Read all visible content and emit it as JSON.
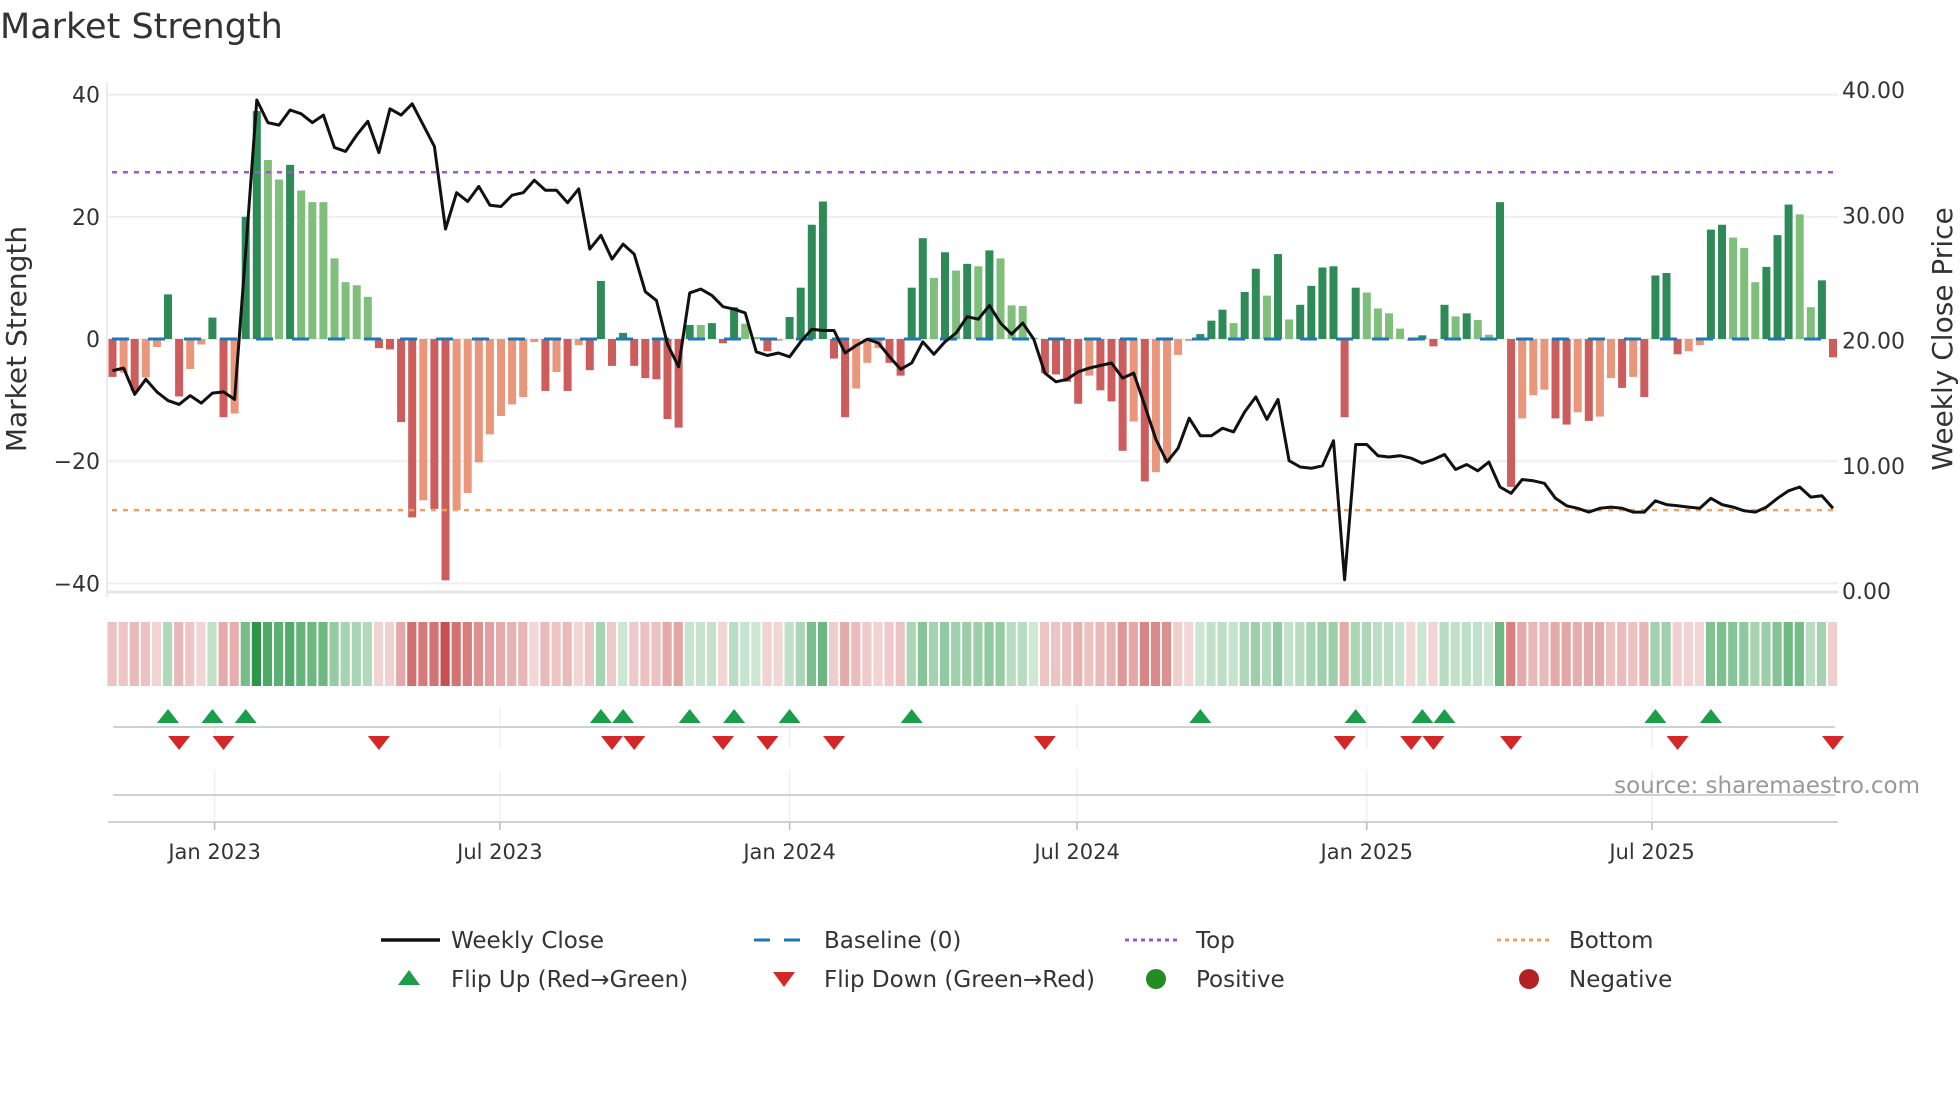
{
  "chart_data": {
    "type": "bar",
    "title": "Market Strength",
    "ylabel": "Market Strength",
    "y2label": "Weekly Close Price",
    "ylim": [
      -42,
      42
    ],
    "y2lim": [
      0,
      42
    ],
    "yticks": [
      {
        "v": 40,
        "label": "40"
      },
      {
        "v": 20,
        "label": "20"
      },
      {
        "v": 0,
        "label": "0"
      },
      {
        "v": -20,
        "label": "−20"
      },
      {
        "v": -40,
        "label": "−40"
      }
    ],
    "y2ticks": [
      {
        "v": 40,
        "label": "40.00"
      },
      {
        "v": 30,
        "label": "30.00"
      },
      {
        "v": 20,
        "label": "20.00"
      },
      {
        "v": 10,
        "label": "10.00"
      },
      {
        "v": 0,
        "label": "0.00"
      }
    ],
    "xticks": [
      {
        "week": 10.2,
        "label": "Jan 2023"
      },
      {
        "week": 35.9,
        "label": "Jul 2023"
      },
      {
        "week": 62.0,
        "label": "Jan 2024"
      },
      {
        "week": 87.9,
        "label": "Jul 2024"
      },
      {
        "week": 114.0,
        "label": "Jan 2025"
      },
      {
        "week": 139.7,
        "label": "Jul 2025"
      }
    ],
    "top_level": 27.3,
    "bottom_level": -28,
    "baseline": 0,
    "strength": [
      -6.2,
      -5.5,
      -8.5,
      -6.3,
      -1.3,
      7.3,
      -9.4,
      -4.9,
      -0.9,
      3.5,
      -12.8,
      -12.2,
      20,
      37.3,
      29.3,
      26.1,
      28.5,
      24.3,
      22.4,
      22.4,
      13.2,
      9.3,
      8.8,
      6.9,
      -1.5,
      -1.7,
      -13.6,
      -29.2,
      -26.4,
      -27.8,
      -39.5,
      -28,
      -25.2,
      -20.2,
      -15.6,
      -12.6,
      -10.7,
      -9.5,
      -0.5,
      -8.5,
      -5.4,
      -8.5,
      -1,
      -5.1,
      9.5,
      -4.4,
      1,
      -4.4,
      -6.4,
      -6.6,
      -13.1,
      -14.5,
      2.3,
      2.3,
      2.6,
      -0.7,
      5.2,
      2.5,
      0.3,
      -2,
      -0.3,
      3.6,
      8.4,
      18.7,
      22.5,
      -3.2,
      -12.8,
      -8.1,
      -3.9,
      -1.5,
      -3.9,
      -6,
      8.4,
      16.5,
      10,
      14.2,
      11.2,
      12.3,
      11.9,
      14.5,
      13.2,
      5.5,
      5.4,
      0.2,
      -5.6,
      -5.8,
      -7,
      -10.6,
      -6,
      -8.4,
      -10.2,
      -18.3,
      -13.5,
      -23.3,
      -21.8,
      -20.2,
      -2.6,
      -0.3,
      0.8,
      3,
      4.8,
      2.6,
      7.7,
      11.5,
      7.1,
      13.9,
      3.2,
      5.6,
      8.7,
      11.7,
      11.9,
      -12.8,
      8.4,
      7.6,
      5,
      4.2,
      1.7,
      -0.3,
      0.6,
      -1.2,
      5.6,
      3.7,
      4.2,
      3.1,
      0.7,
      22.4,
      -24.2,
      -13,
      -9.2,
      -8.3,
      -13,
      -14,
      -12,
      -13.4,
      -12.7,
      -6.4,
      -8,
      -6.2,
      -9.5,
      10.4,
      10.8,
      -2.5,
      -2,
      -1,
      17.9,
      18.7,
      16.6,
      14.9,
      9.3,
      11.8,
      17,
      22,
      20.4,
      5.2,
      9.6,
      -3
    ],
    "tones": [
      "R",
      "r",
      "R",
      "r",
      "r",
      "G",
      "R",
      "r",
      "r",
      "G",
      "R",
      "r",
      "G",
      "G",
      "g",
      "g",
      "G",
      "g",
      "g",
      "g",
      "g",
      "g",
      "g",
      "g",
      "R",
      "R",
      "R",
      "R",
      "r",
      "R",
      "R",
      "r",
      "r",
      "r",
      "r",
      "r",
      "r",
      "r",
      "r",
      "R",
      "r",
      "R",
      "r",
      "R",
      "G",
      "R",
      "G",
      "R",
      "R",
      "R",
      "R",
      "R",
      "G",
      "g",
      "G",
      "R",
      "G",
      "g",
      "g",
      "R",
      "r",
      "G",
      "G",
      "G",
      "G",
      "R",
      "R",
      "r",
      "r",
      "r",
      "R",
      "R",
      "G",
      "G",
      "g",
      "G",
      "g",
      "G",
      "g",
      "G",
      "g",
      "g",
      "g",
      "g",
      "R",
      "R",
      "R",
      "R",
      "r",
      "R",
      "R",
      "R",
      "r",
      "R",
      "r",
      "r",
      "r",
      "r",
      "G",
      "G",
      "G",
      "g",
      "G",
      "G",
      "g",
      "G",
      "g",
      "G",
      "G",
      "G",
      "G",
      "R",
      "G",
      "g",
      "g",
      "g",
      "g",
      "r",
      "G",
      "R",
      "G",
      "g",
      "G",
      "g",
      "g",
      "G",
      "R",
      "r",
      "r",
      "r",
      "R",
      "R",
      "r",
      "R",
      "r",
      "r",
      "R",
      "r",
      "R",
      "G",
      "G",
      "R",
      "r",
      "r",
      "G",
      "G",
      "g",
      "g",
      "g",
      "G",
      "G",
      "G",
      "g",
      "g",
      "G",
      "R"
    ],
    "weekly_close": [
      17.6,
      17.8,
      15.7,
      16.9,
      15.9,
      15.2,
      14.9,
      15.6,
      15.0,
      15.8,
      15.9,
      15.3,
      27.1,
      39.2,
      37.4,
      37.2,
      38.4,
      38.1,
      37.4,
      38.0,
      35.4,
      35.1,
      36.4,
      37.5,
      35.0,
      38.5,
      38.0,
      38.9,
      37.2,
      35.5,
      28.9,
      31.8,
      31.1,
      32.3,
      30.8,
      30.7,
      31.6,
      31.8,
      32.8,
      32.0,
      32.0,
      31.0,
      32.1,
      27.3,
      28.4,
      26.5,
      27.7,
      26.9,
      23.9,
      23.2,
      19.7,
      17.9,
      23.8,
      24.1,
      23.6,
      22.7,
      22.5,
      22.2,
      19.1,
      18.8,
      19.0,
      18.7,
      19.9,
      20.9,
      20.8,
      20.8,
      19.0,
      19.6,
      20.1,
      19.8,
      18.7,
      17.7,
      18.2,
      19.9,
      18.9,
      19.9,
      20.6,
      21.9,
      21.7,
      22.8,
      21.4,
      20.5,
      21.4,
      20.1,
      17.4,
      16.7,
      16.9,
      17.5,
      17.8,
      18.0,
      18.2,
      17.0,
      17.4,
      14.8,
      12.1,
      10.3,
      11.4,
      13.8,
      12.4,
      12.4,
      13.0,
      12.7,
      14.3,
      15.5,
      13.7,
      15.3,
      10.4,
      9.9,
      9.8,
      10.0,
      12.0,
      0.9,
      11.7,
      11.7,
      10.8,
      10.7,
      10.8,
      10.6,
      10.2,
      10.5,
      10.9,
      9.7,
      10.1,
      9.6,
      10.3,
      8.3,
      7.8,
      8.9,
      8.8,
      8.6,
      7.4,
      6.8,
      6.6,
      6.3,
      6.6,
      6.7,
      6.6,
      6.3,
      6.3,
      7.2,
      6.9,
      6.8,
      6.7,
      6.6,
      7.4,
      6.9,
      6.7,
      6.4,
      6.3,
      6.7,
      7.4,
      8.0,
      8.3,
      7.5,
      7.6,
      6.6
    ],
    "flip_up_weeks": [
      6,
      10,
      13,
      45,
      47,
      53,
      57,
      62,
      73,
      99,
      113,
      119,
      121,
      140,
      145
    ],
    "flip_down_weeks": [
      7,
      11,
      25,
      46,
      48,
      56,
      60,
      66,
      85,
      112,
      118,
      120,
      127,
      142,
      156
    ],
    "legend": {
      "placement": "bottom-center",
      "items": [
        {
          "key": "close",
          "label": "Weekly Close"
        },
        {
          "key": "baseline",
          "label": "Baseline (0)"
        },
        {
          "key": "top",
          "label": "Top"
        },
        {
          "key": "bottom",
          "label": "Bottom"
        },
        {
          "key": "flip_up",
          "label": "Flip Up (Red→Green)"
        },
        {
          "key": "flip_down",
          "label": "Flip Down (Green→Red)"
        },
        {
          "key": "positive",
          "label": "Positive"
        },
        {
          "key": "negative",
          "label": "Negative"
        }
      ]
    },
    "source": "source: sharemaestro.com",
    "grid": true
  },
  "colors": {
    "G": "#2e8b57",
    "g": "#7fbf7b",
    "R": "#cd5c5c",
    "r": "#e9967a",
    "close": "#111111",
    "baseline": "#1f77b4",
    "top": "#9b59d0",
    "bottom": "#f0a060",
    "flip_up": "#1a9e4a",
    "flip_down": "#d62728",
    "positive": "#228b22",
    "negative": "#b22222"
  }
}
